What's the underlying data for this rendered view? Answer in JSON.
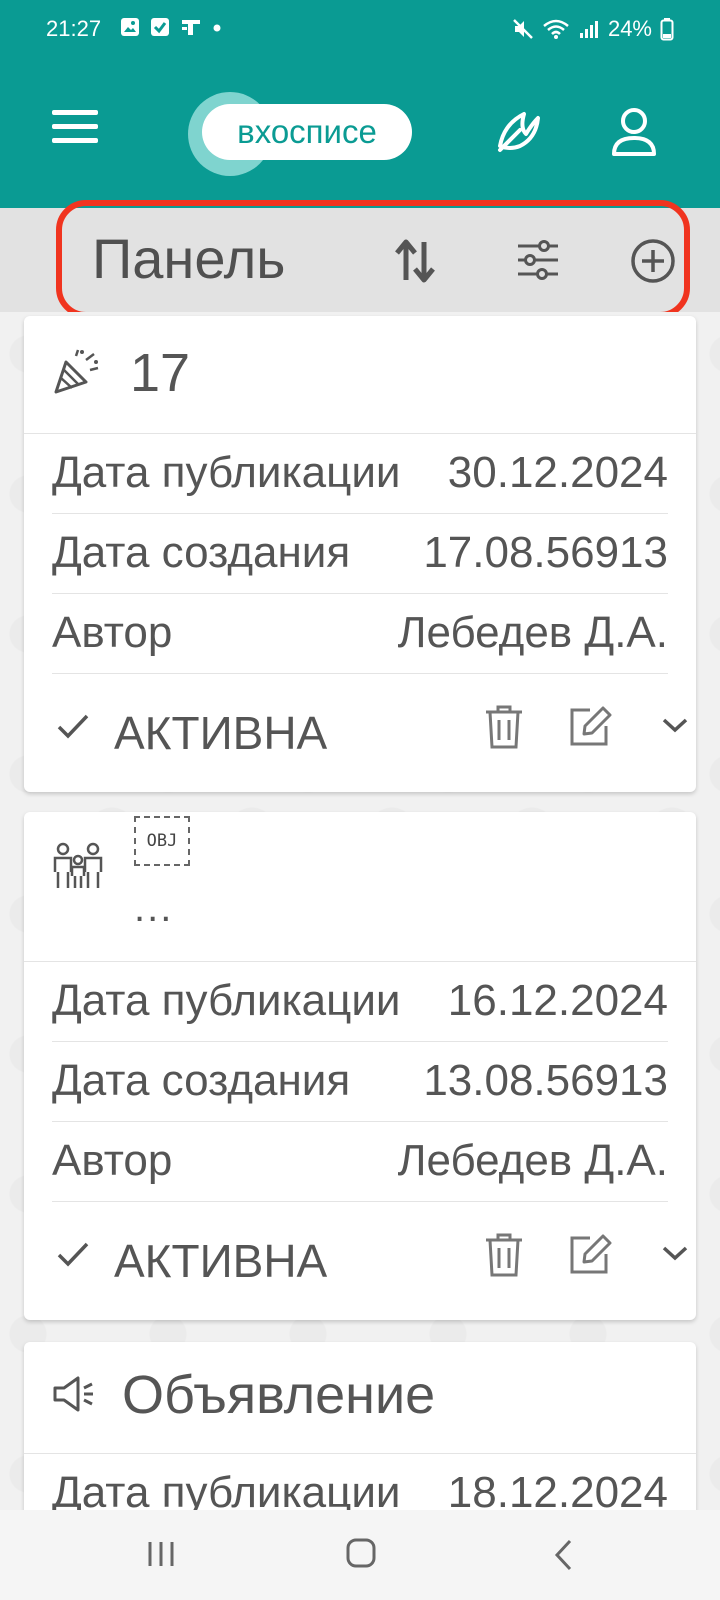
{
  "status_bar": {
    "time": "21:27",
    "battery": "24%",
    "left_icons": [
      "gallery-icon",
      "check-box-icon",
      "teams-icon",
      "dot"
    ],
    "right_icons": [
      "mute-icon",
      "wifi-icon",
      "signal-icon",
      "battery-icon"
    ]
  },
  "appbar": {
    "logo_text": "вхосписе",
    "color": "#0a9b93"
  },
  "toolbar": {
    "title": "Панель",
    "highlight_color": "#f0341f"
  },
  "cards": [
    {
      "icon": "party-popper-icon",
      "title": "17",
      "rows": [
        {
          "label": "Дата публикации",
          "value": "30.12.2024"
        },
        {
          "label": "Дата создания",
          "value": "17.08.56913"
        },
        {
          "label": "Автор",
          "value": "Лебедев Д.А."
        }
      ],
      "status": "АКТИВНА"
    },
    {
      "icon": "family-icon",
      "object_label": "OBJ",
      "more": "...",
      "rows": [
        {
          "label": "Дата публикации",
          "value": "16.12.2024"
        },
        {
          "label": "Дата создания",
          "value": "13.08.56913"
        },
        {
          "label": "Автор",
          "value": "Лебедев Д.А."
        }
      ],
      "status": "АКТИВНА"
    },
    {
      "icon": "megaphone-icon",
      "title": "Объявление",
      "rows": [
        {
          "label": "Дата публикации",
          "value": "18.12.2024"
        }
      ]
    }
  ]
}
